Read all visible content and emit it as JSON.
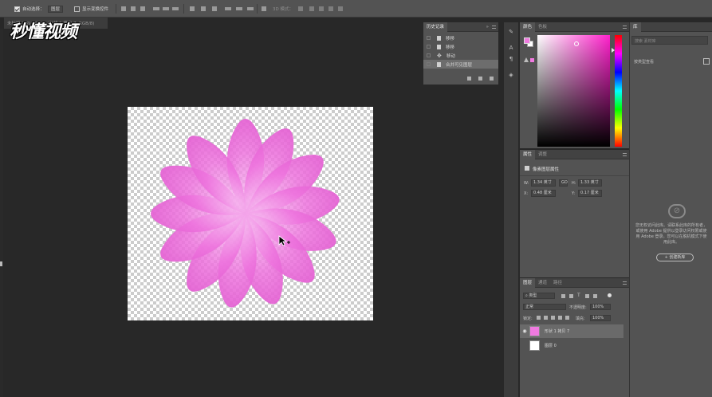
{
  "options_bar": {
    "auto_select_label": "自动选择：",
    "auto_select_value": "图层",
    "show_transform_label": "显示变换控件",
    "mode_3d_label": "3D 模式："
  },
  "document": {
    "tab_title": "未标题-1 @ 66.7% (形状 1 拷贝 7, RGB/8)"
  },
  "watermark": {
    "text": "秒懂视频"
  },
  "history": {
    "tab_label": "历史记录",
    "items": [
      {
        "label": "移移"
      },
      {
        "label": "移移"
      },
      {
        "label": "移动"
      },
      {
        "label": "合并可见图层"
      }
    ]
  },
  "color_panel": {
    "tabs": [
      "颜色",
      "色板"
    ],
    "foreground": "#f07ae0",
    "background": "#ffffff"
  },
  "properties": {
    "tabs": [
      "属性",
      "调整"
    ],
    "title": "像素图层属性",
    "w_label": "W:",
    "w_value": "1.34 英寸",
    "h_label": "H:",
    "h_value": "1.33 英寸",
    "x_label": "X:",
    "x_value": "0.48 厘米",
    "y_label": "Y:",
    "y_value": "0.17 厘米",
    "link_label": "GO"
  },
  "layers": {
    "tabs": [
      "图层",
      "通道",
      "路径"
    ],
    "filter_label": "类型",
    "blend_mode": "正常",
    "opacity_label": "不透明度:",
    "opacity_value": "100%",
    "lock_label": "锁定:",
    "fill_label": "填充:",
    "fill_value": "100%",
    "items": [
      {
        "name": "形状 1 拷贝 7",
        "thumb_color": "#f07ae0"
      },
      {
        "name": "图层 0",
        "thumb_color": "#ffffff"
      }
    ]
  },
  "libraries": {
    "tab_label": "库",
    "search_placeholder": "搜索 素材库",
    "filter_label": "按类型查看",
    "message": "您无权访问此库。请联系此库的所有者，或使用 Adobe 提供以登录访问权限或使用 Adobe 登录。您可以在脱机模式下使用此库。",
    "create_label": "+ 创建新库"
  }
}
